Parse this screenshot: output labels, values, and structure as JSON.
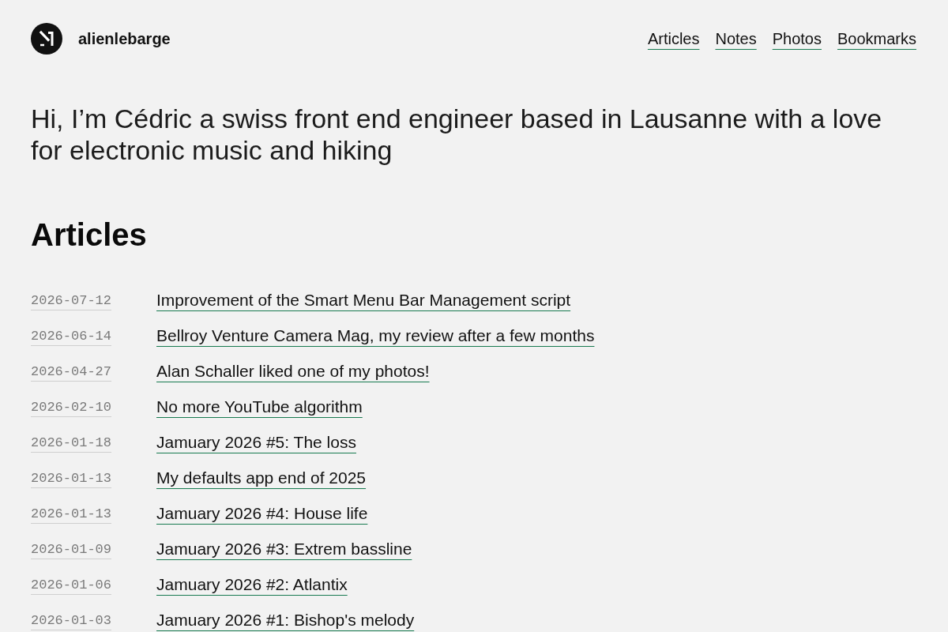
{
  "header": {
    "site_name": "alienlebarge",
    "nav": [
      "Articles",
      "Notes",
      "Photos",
      "Bookmarks"
    ]
  },
  "intro": "Hi, I’m Cédric a swiss front end engineer based in Lausanne with a love for electronic music and hiking",
  "articles": {
    "title": "Articles",
    "items": [
      {
        "date": "2026-07-12",
        "title": "Improvement of the Smart Menu Bar Management script"
      },
      {
        "date": "2026-06-14",
        "title": "Bellroy Venture Camera Mag, my review after a few months"
      },
      {
        "date": "2026-04-27",
        "title": "Alan Schaller liked one of my photos!"
      },
      {
        "date": "2026-02-10",
        "title": "No more YouTube algorithm"
      },
      {
        "date": "2026-01-18",
        "title": "Jamuary 2026 #5: The loss"
      },
      {
        "date": "2026-01-13",
        "title": "My defaults app end of 2025"
      },
      {
        "date": "2026-01-13",
        "title": "Jamuary 2026 #4: House life"
      },
      {
        "date": "2026-01-09",
        "title": "Jamuary 2026 #3: Extrem bassline"
      },
      {
        "date": "2026-01-06",
        "title": "Jamuary 2026 #2: Atlantix"
      },
      {
        "date": "2026-01-03",
        "title": "Jamuary 2026 #1: Bishop's melody"
      }
    ]
  }
}
